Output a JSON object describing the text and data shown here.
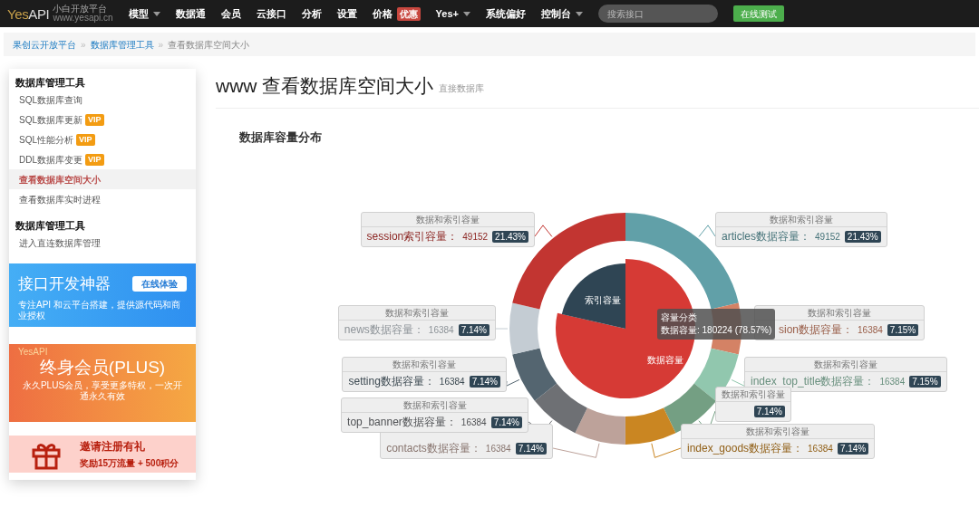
{
  "navbar": {
    "logo": {
      "brand_a": "Yes",
      "brand_b": "API",
      "tagline": "小白开放平台",
      "url": "www.yesapi.cn"
    },
    "menu": [
      {
        "label": "模型",
        "dropdown": true
      },
      {
        "label": "数据通",
        "dropdown": false
      },
      {
        "label": "会员",
        "dropdown": false
      },
      {
        "label": "云接口",
        "dropdown": false
      },
      {
        "label": "分析",
        "dropdown": false
      },
      {
        "label": "设置",
        "dropdown": false
      },
      {
        "label": "价格",
        "dropdown": false,
        "badge": "优惠"
      },
      {
        "label": "Yes+",
        "dropdown": true
      },
      {
        "label": "系统偏好",
        "dropdown": false
      },
      {
        "label": "控制台",
        "dropdown": true
      }
    ],
    "search": {
      "placeholder": "搜索接口"
    },
    "test_button": "在线测试"
  },
  "breadcrumb": {
    "separator": "»",
    "items": [
      {
        "label": "果创云开放平台",
        "link": true
      },
      {
        "label": "数据库管理工具",
        "link": true
      },
      {
        "label": "查看数据库空间大小",
        "link": false
      }
    ]
  },
  "sidebar": {
    "sections": [
      {
        "title": "数据库管理工具",
        "items": [
          {
            "label": "SQL数据库查询",
            "selected": false
          },
          {
            "label": "SQL数据库更新",
            "badge": "VIP",
            "selected": false
          },
          {
            "label": "SQL性能分析",
            "badge": "VIP",
            "selected": false
          },
          {
            "label": "DDL数据库变更",
            "badge": "VIP",
            "selected": false
          },
          {
            "label": "查看数据库空间大小",
            "selected": true
          },
          {
            "label": "查看数据库实时进程",
            "selected": false
          }
        ]
      },
      {
        "title": "数据库管理工具",
        "items": [
          {
            "label": "进入直连数据库管理",
            "selected": false
          }
        ]
      }
    ],
    "banners": [
      {
        "kind": "api",
        "title": "接口开发神器",
        "button": "在线体验",
        "subtitle": "专注API 和云平台搭建，提供源代码和商业授权"
      },
      {
        "kind": "plus",
        "logo": "YesAPI",
        "title": "终身会员(PLUS)",
        "subtitle": "永久PLUS会员，享受更多特权，一次开通永久有效"
      },
      {
        "kind": "invite",
        "title": "邀请注册有礼",
        "subtitle": "奖励15万流量 + 500积分"
      }
    ]
  },
  "page": {
    "title": "www 查看数据库空间大小",
    "subtitle": "直接数据库",
    "section_title": "数据库容量分布"
  },
  "chart": {
    "inner": {
      "chart_data": {
        "type": "pie",
        "categories": [
          "数据容量",
          "索引容量"
        ],
        "values": [
          78.57,
          21.43
        ]
      }
    },
    "outer": {
      "chart_data": {
        "type": "donut",
        "values": [
          21.43,
          7.15,
          7.15,
          7.14,
          7.14,
          7.14,
          7.14,
          7.14,
          7.14,
          21.43
        ]
      }
    },
    "labels": [
      {
        "header": "数据和索引容量",
        "name": "session索引容量：",
        "value": "49152",
        "percent": "21.43%",
        "color": "#c23531"
      },
      {
        "header": "数据和索引容量",
        "name": "articles数据容量：",
        "value": "49152",
        "percent": "21.43%",
        "color": "#61a0a8"
      },
      {
        "header": "数据和索引容量",
        "name": "news数据容量：",
        "value": "16384",
        "percent": "7.14%",
        "color": "#c4ccd3"
      },
      {
        "header": "数据和索引容量",
        "name": "sion数据容量：",
        "value": "16384",
        "percent": "7.15%",
        "color": "#d48265"
      },
      {
        "header": "数据和索引容量",
        "name": "setting数据容量：",
        "value": "16384",
        "percent": "7.14%",
        "color": "#546570"
      },
      {
        "header": "数据和索引容量",
        "name": "index_top_title数据容量：",
        "value": "16384",
        "percent": "7.15%",
        "color": "#91c7ae"
      },
      {
        "header": "数据和索引容量",
        "name": "top_banner数据容量：",
        "value": "16384",
        "percent": "7.14%",
        "color": "#6e7074"
      },
      {
        "header": "数据和索引容量",
        "percent": "7.14%",
        "color": "#749f83"
      },
      {
        "name": "contacts数据容量：",
        "value": "16384",
        "percent": "7.14%",
        "color": "#bda29a"
      },
      {
        "header": "数据和索引容量",
        "name": "index_goods数据容量：",
        "value": "16384",
        "percent": "7.14%",
        "color": "#ca8622"
      }
    ],
    "tooltip": {
      "title": "容量分类",
      "line": "数据容量: 180224 (78.57%)"
    }
  }
}
